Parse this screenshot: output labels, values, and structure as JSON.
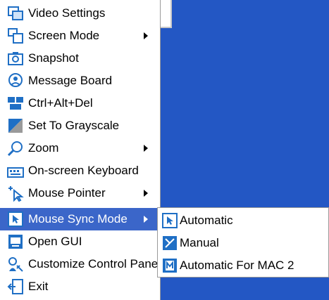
{
  "colors": {
    "accent": "#3b66c9",
    "desktop": "#2357c4"
  },
  "menu": {
    "items": [
      {
        "label": "Video Settings",
        "icon": "video-settings-icon",
        "submenu": false
      },
      {
        "label": "Screen Mode",
        "icon": "screen-mode-icon",
        "submenu": true
      },
      {
        "label": "Snapshot",
        "icon": "camera-icon",
        "submenu": false
      },
      {
        "label": "Message Board",
        "icon": "message-board-icon",
        "submenu": false
      },
      {
        "label": "Ctrl+Alt+Del",
        "icon": "keys-icon",
        "submenu": false
      },
      {
        "label": "Set To Grayscale",
        "icon": "grayscale-icon",
        "submenu": false
      },
      {
        "label": "Zoom",
        "icon": "zoom-icon",
        "submenu": true
      },
      {
        "label": "On-screen Keyboard",
        "icon": "keyboard-icon",
        "submenu": false
      },
      {
        "label": "Mouse Pointer",
        "icon": "mouse-pointer-icon",
        "submenu": true
      },
      {
        "label": "Mouse Sync Mode",
        "icon": "mouse-sync-icon",
        "submenu": true,
        "selected": true
      },
      {
        "label": "Open GUI",
        "icon": "gui-icon",
        "submenu": false
      },
      {
        "label": "Customize Control Panel",
        "icon": "customize-icon",
        "submenu": false
      },
      {
        "label": "Exit",
        "icon": "exit-icon",
        "submenu": false
      }
    ]
  },
  "submenu": {
    "items": [
      {
        "label": "Automatic",
        "icon": "automatic-sync-icon"
      },
      {
        "label": "Manual",
        "icon": "manual-sync-icon"
      },
      {
        "label": "Automatic For MAC 2",
        "icon": "mac-sync-icon"
      }
    ]
  }
}
